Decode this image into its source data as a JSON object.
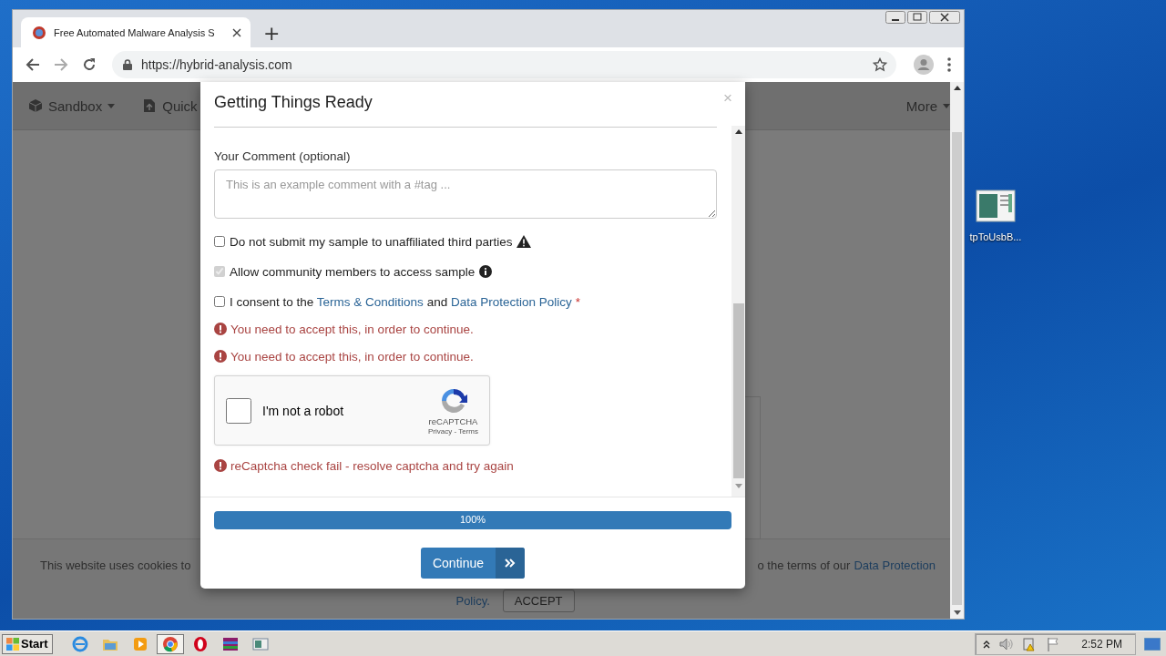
{
  "browser": {
    "tab": {
      "title": "Free Automated Malware Analysis S",
      "selected": true
    },
    "new_tab": "+",
    "url": "https://hybrid-analysis.com"
  },
  "page": {
    "nav": [
      {
        "label": "Sandbox",
        "kind": "box",
        "dropdown": true
      },
      {
        "label": "Quick",
        "kind": "upload",
        "dropdown": false
      }
    ],
    "nav_right": {
      "label": "More",
      "dropdown": true
    },
    "cookie_banner": {
      "text_left": "This website uses cookies to",
      "text_right": "o the terms of our",
      "link": "Data Protection",
      "link_line2": "Policy.",
      "button": "ACCEPT"
    }
  },
  "modal": {
    "title": "Getting Things Ready",
    "close": "×",
    "comment": {
      "label": "Your Comment (optional)",
      "placeholder": "This is an example comment with a #tag ..."
    },
    "options": [
      {
        "parts": [
          {
            "text": "Do not submit my sample to unaffiliated third parties",
            "link": false
          }
        ],
        "checked": false,
        "disabled": false,
        "kind": "warning"
      },
      {
        "parts": [
          {
            "text": "Allow community members to access sample",
            "link": false
          }
        ],
        "checked": true,
        "disabled": true,
        "kind": "info"
      },
      {
        "parts": [
          {
            "text": "I consent to the ",
            "link": false
          },
          {
            "text": "Terms & Conditions",
            "link": true
          },
          {
            "text": " and ",
            "link": false
          },
          {
            "text": "Data Protection Policy",
            "link": true
          }
        ],
        "checked": false,
        "disabled": false,
        "kind": "consent",
        "required_mark": "*"
      }
    ],
    "errors": [
      "You need to accept this, in order to continue.",
      "You need to accept this, in order to continue."
    ],
    "captcha": {
      "label": "I'm not a robot",
      "checked": false,
      "brand": "reCAPTCHA",
      "links": "Privacy - Terms"
    },
    "captcha_error": "reCaptcha check fail - resolve captcha and try again",
    "progress": {
      "level": 1,
      "reading": "100%"
    },
    "continue": "Continue"
  },
  "desktop": {
    "icon_label": "tpToUsbB..."
  },
  "taskbar": {
    "start": "Start",
    "apps": [
      {
        "kind": "ie",
        "selected": false
      },
      {
        "kind": "folder",
        "selected": false
      },
      {
        "kind": "media",
        "selected": false
      },
      {
        "kind": "chrome",
        "selected": true
      },
      {
        "kind": "opera",
        "selected": false
      },
      {
        "kind": "archive",
        "selected": false
      },
      {
        "kind": "window",
        "selected": false
      }
    ],
    "clock": "2:52 PM"
  }
}
